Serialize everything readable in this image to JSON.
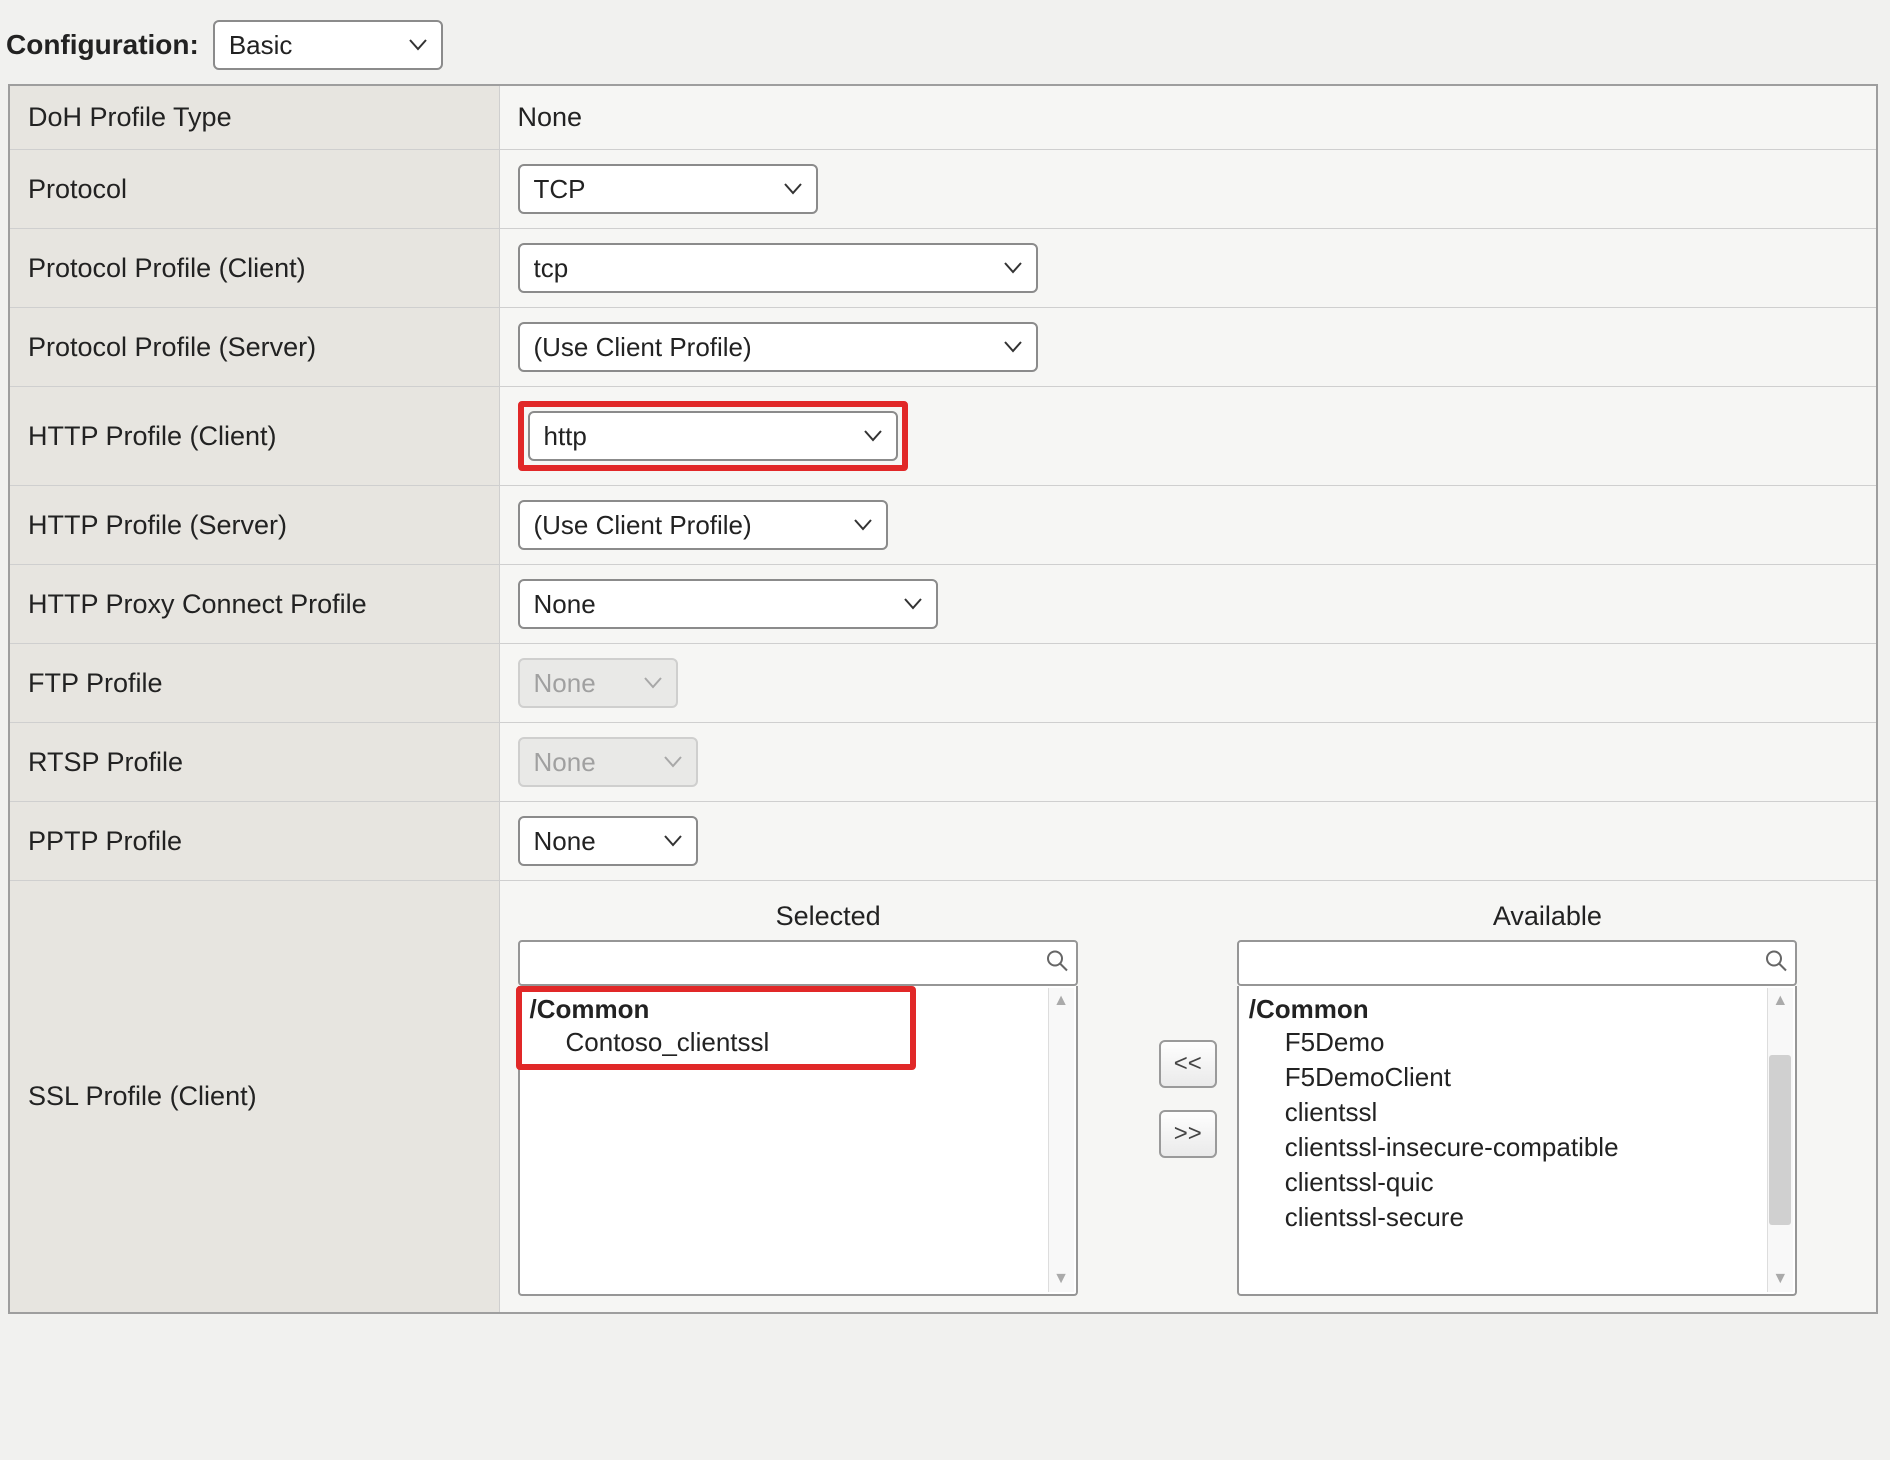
{
  "header": {
    "configuration_label": "Configuration:",
    "configuration_value": "Basic"
  },
  "rows": {
    "doh_profile_type": {
      "label": "DoH Profile Type",
      "value": "None"
    },
    "protocol": {
      "label": "Protocol",
      "value": "TCP"
    },
    "protocol_profile_client": {
      "label": "Protocol Profile (Client)",
      "value": "tcp"
    },
    "protocol_profile_server": {
      "label": "Protocol Profile (Server)",
      "value": "(Use Client Profile)"
    },
    "http_profile_client": {
      "label": "HTTP Profile (Client)",
      "value": "http"
    },
    "http_profile_server": {
      "label": "HTTP Profile (Server)",
      "value": "(Use Client Profile)"
    },
    "http_proxy_connect_profile": {
      "label": "HTTP Proxy Connect Profile",
      "value": "None"
    },
    "ftp_profile": {
      "label": "FTP Profile",
      "value": "None"
    },
    "rtsp_profile": {
      "label": "RTSP Profile",
      "value": "None"
    },
    "pptp_profile": {
      "label": "PPTP Profile",
      "value": "None"
    },
    "ssl_profile_client": {
      "label": "SSL Profile (Client)"
    }
  },
  "ssl_duallist": {
    "selected_header": "Selected",
    "available_header": "Available",
    "move_left_label": "<<",
    "move_right_label": ">>",
    "selected": {
      "group": "/Common",
      "items": [
        "Contoso_clientssl"
      ]
    },
    "available": {
      "group": "/Common",
      "items": [
        "F5Demo",
        "F5DemoClient",
        "clientssl",
        "clientssl-insecure-compatible",
        "clientssl-quic",
        "clientssl-secure"
      ]
    }
  }
}
